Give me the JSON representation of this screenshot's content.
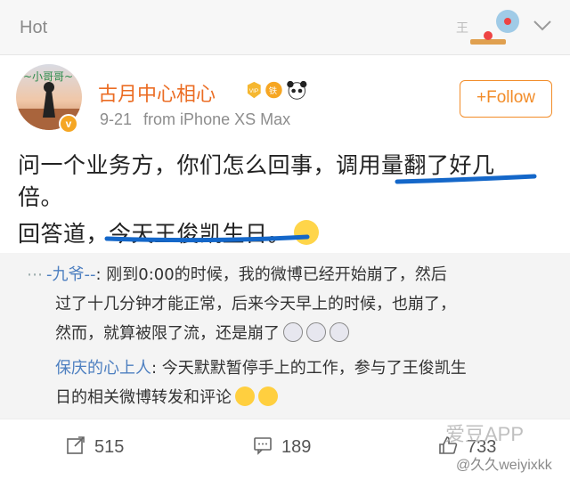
{
  "topbar": {
    "title": "Hot"
  },
  "post": {
    "username": "古月中心相心",
    "time": "9-21",
    "source": "from iPhone XS Max",
    "follow_label": "+Follow",
    "line1": "问一个业务方，你们怎么回事，调用量翻了好几",
    "line2": "倍。",
    "line3": "回答道，今天王俊凯生日。"
  },
  "quote": {
    "c1_user": "-九爷--",
    "c1_text1": ": 刚到0:00的时候，我的微博已经开始崩了，然后",
    "c1_text2": "过了十几分钟才能正常，后来今天早上的时候，也崩了，",
    "c1_text3": "然而，就算被限了流，还是崩了",
    "c2_user": "保庆的心上人",
    "c2_text1": ": 今天默默暂停手上的工作，参与了王俊凯生",
    "c2_text2": "日的相关微博转发和评论"
  },
  "actions": {
    "repost": "515",
    "comment": "189",
    "like": "733"
  },
  "watermark": {
    "app": "爱豆APP",
    "handle": "@久久weiyixkk"
  },
  "colors": {
    "accent": "#f28c28",
    "username": "#eb6d24",
    "link": "#4d7fc0",
    "underline": "#1467c9"
  },
  "icons": [
    "chevron-down-icon",
    "vip-badge-icon",
    "panda-icon",
    "verified-icon",
    "repost-icon",
    "comment-icon",
    "like-icon"
  ]
}
